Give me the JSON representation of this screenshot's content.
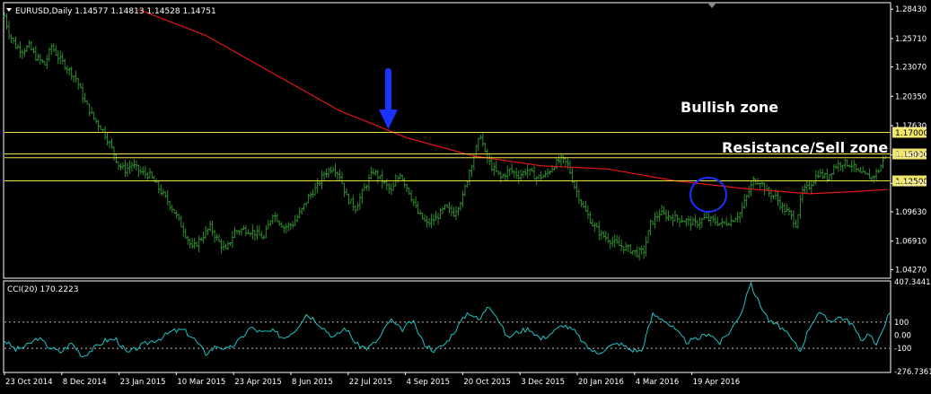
{
  "symbol_header": {
    "text": "EURUSD,Daily  1.14577 1.14813 1.14528 1.14751"
  },
  "cci_header": {
    "text": "CCI(20) 170.2223"
  },
  "annotations": {
    "bullish_zone": "Bullish zone",
    "resistance_zone": "Resistance/Sell zone"
  },
  "colors": {
    "background": "#000000",
    "grid": "#ffffff",
    "bars": "#2e8b2e",
    "moving_average": "#e0161b",
    "level_lines": "#f0e040",
    "cci_line": "#1ec4c4",
    "arrow": "#1a33ff",
    "circle": "#1a33ff",
    "text": "#ffffff"
  },
  "chart_data": [
    {
      "type": "ohlc",
      "name": "EURUSD Daily",
      "price_axis": {
        "ticks": [
          "1.28430",
          "1.25710",
          "1.23070",
          "1.20350",
          "1.17630",
          "1.14910",
          "1.12270",
          "1.09630",
          "1.06910",
          "1.04270"
        ],
        "range": [
          1.0355,
          1.2895
        ]
      },
      "time_axis": {
        "tick_labels": [
          "23 Oct 2014",
          "8 Dec 2014",
          "23 Jan 2015",
          "10 Mar 2015",
          "23 Apr 2015",
          "8 Jun 2015",
          "22 Jul 2015",
          "4 Sep 2015",
          "20 Oct 2015",
          "3 Dec 2015",
          "20 Jan 2016",
          "4 Mar 2016",
          "19 Apr 2016"
        ]
      },
      "last_bar": {
        "open": 1.14577,
        "high": 1.14813,
        "low": 1.14528,
        "close": 1.14751
      },
      "close_path": [
        {
          "i": 0,
          "close": 1.278
        },
        {
          "i": 4,
          "close": 1.262
        },
        {
          "i": 10,
          "close": 1.25
        },
        {
          "i": 16,
          "close": 1.246
        },
        {
          "i": 22,
          "close": 1.25
        },
        {
          "i": 28,
          "close": 1.24
        },
        {
          "i": 36,
          "close": 1.233
        },
        {
          "i": 42,
          "close": 1.25
        },
        {
          "i": 48,
          "close": 1.24
        },
        {
          "i": 56,
          "close": 1.23
        },
        {
          "i": 64,
          "close": 1.22
        },
        {
          "i": 72,
          "close": 1.198
        },
        {
          "i": 80,
          "close": 1.183
        },
        {
          "i": 88,
          "close": 1.172
        },
        {
          "i": 96,
          "close": 1.155
        },
        {
          "i": 102,
          "close": 1.14
        },
        {
          "i": 108,
          "close": 1.135
        },
        {
          "i": 114,
          "close": 1.14
        },
        {
          "i": 122,
          "close": 1.133
        },
        {
          "i": 130,
          "close": 1.13
        },
        {
          "i": 140,
          "close": 1.115
        },
        {
          "i": 150,
          "close": 1.1
        },
        {
          "i": 160,
          "close": 1.08
        },
        {
          "i": 168,
          "close": 1.062
        },
        {
          "i": 176,
          "close": 1.072
        },
        {
          "i": 184,
          "close": 1.082
        },
        {
          "i": 192,
          "close": 1.068
        },
        {
          "i": 198,
          "close": 1.06
        },
        {
          "i": 206,
          "close": 1.078
        },
        {
          "i": 214,
          "close": 1.08
        },
        {
          "i": 222,
          "close": 1.078
        },
        {
          "i": 232,
          "close": 1.072
        },
        {
          "i": 240,
          "close": 1.095
        },
        {
          "i": 250,
          "close": 1.082
        },
        {
          "i": 258,
          "close": 1.085
        },
        {
          "i": 266,
          "close": 1.098
        },
        {
          "i": 272,
          "close": 1.11
        },
        {
          "i": 280,
          "close": 1.12
        },
        {
          "i": 286,
          "close": 1.132
        },
        {
          "i": 294,
          "close": 1.138
        },
        {
          "i": 300,
          "close": 1.13
        },
        {
          "i": 306,
          "close": 1.11
        },
        {
          "i": 314,
          "close": 1.1
        },
        {
          "i": 322,
          "close": 1.118
        },
        {
          "i": 330,
          "close": 1.134
        },
        {
          "i": 338,
          "close": 1.125
        },
        {
          "i": 346,
          "close": 1.115
        },
        {
          "i": 354,
          "close": 1.132
        },
        {
          "i": 362,
          "close": 1.115
        },
        {
          "i": 370,
          "close": 1.095
        },
        {
          "i": 378,
          "close": 1.085
        },
        {
          "i": 386,
          "close": 1.09
        },
        {
          "i": 394,
          "close": 1.1
        },
        {
          "i": 402,
          "close": 1.095
        },
        {
          "i": 410,
          "close": 1.11
        },
        {
          "i": 416,
          "close": 1.135
        },
        {
          "i": 422,
          "close": 1.155
        },
        {
          "i": 426,
          "close": 1.168
        },
        {
          "i": 430,
          "close": 1.15
        },
        {
          "i": 436,
          "close": 1.138
        },
        {
          "i": 444,
          "close": 1.128
        },
        {
          "i": 452,
          "close": 1.135
        },
        {
          "i": 460,
          "close": 1.13
        },
        {
          "i": 468,
          "close": 1.135
        },
        {
          "i": 476,
          "close": 1.128
        },
        {
          "i": 484,
          "close": 1.13
        },
        {
          "i": 492,
          "close": 1.14
        },
        {
          "i": 498,
          "close": 1.145
        },
        {
          "i": 504,
          "close": 1.14
        },
        {
          "i": 510,
          "close": 1.12
        },
        {
          "i": 518,
          "close": 1.1
        },
        {
          "i": 526,
          "close": 1.085
        },
        {
          "i": 534,
          "close": 1.075
        },
        {
          "i": 542,
          "close": 1.07
        },
        {
          "i": 550,
          "close": 1.065
        },
        {
          "i": 558,
          "close": 1.062
        },
        {
          "i": 566,
          "close": 1.058
        },
        {
          "i": 572,
          "close": 1.06
        },
        {
          "i": 578,
          "close": 1.085
        },
        {
          "i": 586,
          "close": 1.095
        },
        {
          "i": 594,
          "close": 1.092
        },
        {
          "i": 602,
          "close": 1.09
        },
        {
          "i": 610,
          "close": 1.088
        },
        {
          "i": 618,
          "close": 1.085
        },
        {
          "i": 626,
          "close": 1.09
        },
        {
          "i": 634,
          "close": 1.088
        },
        {
          "i": 642,
          "close": 1.085
        },
        {
          "i": 650,
          "close": 1.088
        },
        {
          "i": 658,
          "close": 1.095
        },
        {
          "i": 664,
          "close": 1.11
        },
        {
          "i": 670,
          "close": 1.125
        },
        {
          "i": 676,
          "close": 1.125
        },
        {
          "i": 682,
          "close": 1.115
        },
        {
          "i": 690,
          "close": 1.11
        },
        {
          "i": 696,
          "close": 1.1
        },
        {
          "i": 702,
          "close": 1.095
        },
        {
          "i": 708,
          "close": 1.085
        },
        {
          "i": 714,
          "close": 1.115
        },
        {
          "i": 720,
          "close": 1.12
        },
        {
          "i": 728,
          "close": 1.132
        },
        {
          "i": 736,
          "close": 1.128
        },
        {
          "i": 742,
          "close": 1.138
        },
        {
          "i": 750,
          "close": 1.142
        },
        {
          "i": 758,
          "close": 1.14
        },
        {
          "i": 764,
          "close": 1.132
        },
        {
          "i": 770,
          "close": 1.13
        },
        {
          "i": 776,
          "close": 1.128
        },
        {
          "i": 782,
          "close": 1.135
        },
        {
          "i": 788,
          "close": 1.147
        }
      ],
      "moving_average": [
        {
          "i": 120,
          "value": 1.284
        },
        {
          "i": 180,
          "value": 1.26
        },
        {
          "i": 240,
          "value": 1.225
        },
        {
          "i": 300,
          "value": 1.19
        },
        {
          "i": 360,
          "value": 1.165
        },
        {
          "i": 420,
          "value": 1.148
        },
        {
          "i": 480,
          "value": 1.139
        },
        {
          "i": 540,
          "value": 1.136
        },
        {
          "i": 600,
          "value": 1.125
        },
        {
          "i": 660,
          "value": 1.118
        },
        {
          "i": 720,
          "value": 1.113
        },
        {
          "i": 760,
          "value": 1.115
        },
        {
          "i": 790,
          "value": 1.117
        }
      ],
      "levels": [
        {
          "label": "1.17000",
          "value": 1.17
        },
        {
          "label": "1.15000",
          "value": 1.15
        },
        {
          "label": "1.12500",
          "value": 1.125
        }
      ],
      "extra_level": 1.1465
    },
    {
      "type": "line",
      "name": "CCI(20)",
      "value": 170.2223,
      "axis_ticks": [
        "407.3441",
        "100",
        "0.00",
        "-100",
        "-276.7361"
      ],
      "range": [
        -276.7361,
        407.3441
      ],
      "reference_lines": [
        100,
        -100
      ],
      "values": [
        {
          "i": 0,
          "v": -40
        },
        {
          "i": 10,
          "v": -110
        },
        {
          "i": 20,
          "v": -80
        },
        {
          "i": 30,
          "v": -20
        },
        {
          "i": 40,
          "v": -90
        },
        {
          "i": 50,
          "v": -130
        },
        {
          "i": 60,
          "v": -60
        },
        {
          "i": 70,
          "v": -160
        },
        {
          "i": 80,
          "v": -100
        },
        {
          "i": 90,
          "v": -40
        },
        {
          "i": 100,
          "v": -30
        },
        {
          "i": 110,
          "v": -140
        },
        {
          "i": 120,
          "v": -90
        },
        {
          "i": 130,
          "v": -50
        },
        {
          "i": 140,
          "v": -20
        },
        {
          "i": 150,
          "v": 30
        },
        {
          "i": 160,
          "v": 40
        },
        {
          "i": 170,
          "v": -30
        },
        {
          "i": 180,
          "v": -140
        },
        {
          "i": 190,
          "v": -80
        },
        {
          "i": 200,
          "v": -110
        },
        {
          "i": 210,
          "v": -40
        },
        {
          "i": 220,
          "v": 60
        },
        {
          "i": 230,
          "v": 20
        },
        {
          "i": 240,
          "v": 30
        },
        {
          "i": 250,
          "v": -20
        },
        {
          "i": 260,
          "v": 40
        },
        {
          "i": 270,
          "v": 160
        },
        {
          "i": 276,
          "v": 130
        },
        {
          "i": 285,
          "v": 60
        },
        {
          "i": 295,
          "v": -20
        },
        {
          "i": 305,
          "v": 60
        },
        {
          "i": 315,
          "v": -70
        },
        {
          "i": 325,
          "v": -100
        },
        {
          "i": 335,
          "v": -30
        },
        {
          "i": 345,
          "v": 120
        },
        {
          "i": 355,
          "v": 40
        },
        {
          "i": 365,
          "v": 110
        },
        {
          "i": 375,
          "v": -60
        },
        {
          "i": 385,
          "v": -120
        },
        {
          "i": 395,
          "v": -60
        },
        {
          "i": 405,
          "v": 60
        },
        {
          "i": 415,
          "v": 180
        },
        {
          "i": 425,
          "v": 110
        },
        {
          "i": 433,
          "v": 240
        },
        {
          "i": 440,
          "v": 150
        },
        {
          "i": 450,
          "v": -20
        },
        {
          "i": 460,
          "v": 30
        },
        {
          "i": 470,
          "v": 50
        },
        {
          "i": 480,
          "v": -30
        },
        {
          "i": 490,
          "v": 20
        },
        {
          "i": 500,
          "v": 80
        },
        {
          "i": 510,
          "v": 30
        },
        {
          "i": 520,
          "v": -80
        },
        {
          "i": 530,
          "v": -140
        },
        {
          "i": 540,
          "v": -90
        },
        {
          "i": 550,
          "v": -60
        },
        {
          "i": 560,
          "v": -110
        },
        {
          "i": 570,
          "v": -120
        },
        {
          "i": 580,
          "v": 160
        },
        {
          "i": 590,
          "v": 120
        },
        {
          "i": 600,
          "v": 40
        },
        {
          "i": 610,
          "v": -50
        },
        {
          "i": 620,
          "v": -30
        },
        {
          "i": 630,
          "v": 20
        },
        {
          "i": 640,
          "v": -60
        },
        {
          "i": 650,
          "v": 40
        },
        {
          "i": 660,
          "v": 190
        },
        {
          "i": 667,
          "v": 400
        },
        {
          "i": 675,
          "v": 250
        },
        {
          "i": 685,
          "v": 100
        },
        {
          "i": 695,
          "v": 60
        },
        {
          "i": 705,
          "v": -40
        },
        {
          "i": 712,
          "v": -120
        },
        {
          "i": 720,
          "v": 60
        },
        {
          "i": 728,
          "v": 170
        },
        {
          "i": 738,
          "v": 110
        },
        {
          "i": 748,
          "v": 140
        },
        {
          "i": 758,
          "v": 90
        },
        {
          "i": 766,
          "v": -40
        },
        {
          "i": 774,
          "v": 20
        },
        {
          "i": 780,
          "v": -90
        },
        {
          "i": 786,
          "v": 60
        },
        {
          "i": 792,
          "v": 170
        }
      ]
    }
  ]
}
